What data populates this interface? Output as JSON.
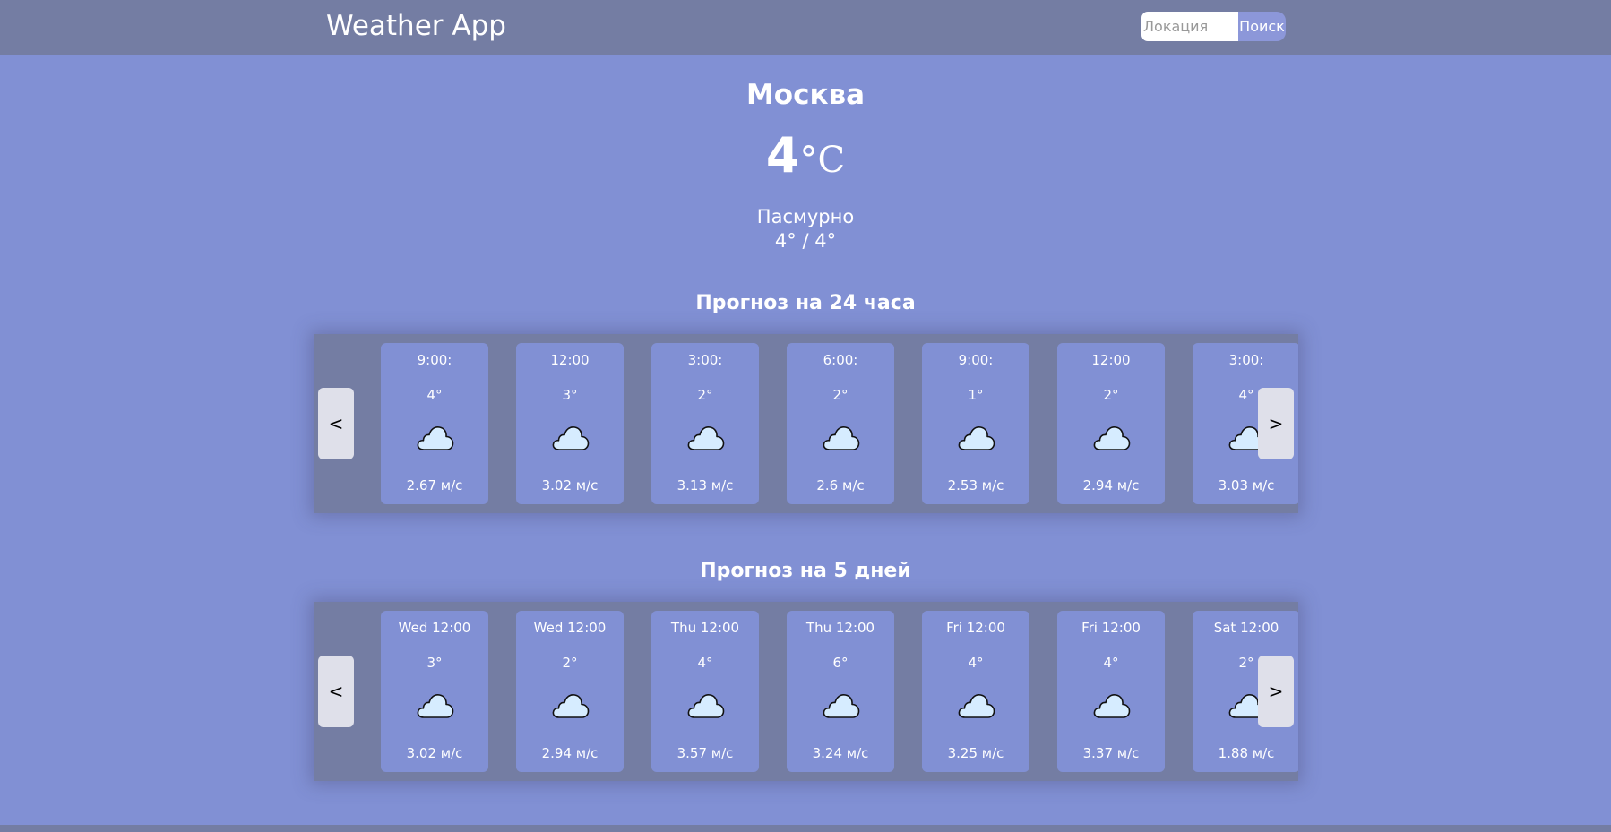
{
  "header": {
    "title": "Weather App",
    "search_placeholder": "Локация",
    "search_value": "",
    "search_button": "Поиск"
  },
  "current": {
    "city": "Москва",
    "temp": "4",
    "unit": "°C",
    "description": "Пасмурно",
    "minmax": "4° / 4°"
  },
  "hourly": {
    "title": "Прогноз на 24 часа",
    "prev_label": "<",
    "next_label": ">",
    "icon": "cloud-icon",
    "items": [
      {
        "time": "9:00:",
        "temp": "4°",
        "wind": "2.67 м/с"
      },
      {
        "time": "12:00",
        "temp": "3°",
        "wind": "3.02 м/с"
      },
      {
        "time": "3:00:",
        "temp": "2°",
        "wind": "3.13 м/с"
      },
      {
        "time": "6:00:",
        "temp": "2°",
        "wind": "2.6 м/с"
      },
      {
        "time": "9:00:",
        "temp": "1°",
        "wind": "2.53 м/с"
      },
      {
        "time": "12:00",
        "temp": "2°",
        "wind": "2.94 м/с"
      },
      {
        "time": "3:00:",
        "temp": "4°",
        "wind": "3.03 м/с"
      }
    ]
  },
  "daily": {
    "title": "Прогноз на 5 дней",
    "prev_label": "<",
    "next_label": ">",
    "icon": "cloud-icon",
    "items": [
      {
        "time": "Wed 12:00",
        "temp": "3°",
        "wind": "3.02 м/с"
      },
      {
        "time": "Wed 12:00",
        "temp": "2°",
        "wind": "2.94 м/с"
      },
      {
        "time": "Thu 12:00",
        "temp": "4°",
        "wind": "3.57 м/с"
      },
      {
        "time": "Thu 12:00",
        "temp": "6°",
        "wind": "3.24 м/с"
      },
      {
        "time": "Fri 12:00",
        "temp": "4°",
        "wind": "3.25 м/с"
      },
      {
        "time": "Fri 12:00",
        "temp": "4°",
        "wind": "3.37 м/с"
      },
      {
        "time": "Sat 12:00",
        "temp": "2°",
        "wind": "1.88 м/с"
      }
    ]
  },
  "colors": {
    "page_background": "#8190d4",
    "header_background": "#747da3",
    "card_background": "#8190d4",
    "nav_button": "#dfe0ea",
    "cloud_fill": "#d6ecff"
  }
}
